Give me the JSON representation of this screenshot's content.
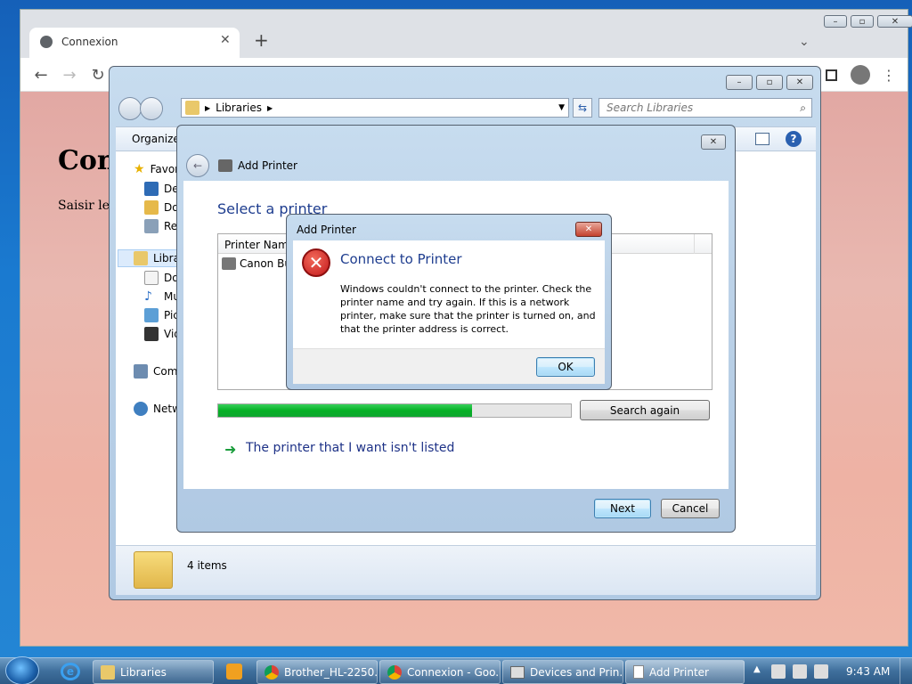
{
  "browser": {
    "tab_title": "Connexion",
    "heading": "Con",
    "body_text": "Saisir le s"
  },
  "explorer": {
    "breadcrumb": "Libraries",
    "search_placeholder": "Search Libraries",
    "organize_label": "Organize",
    "nav": {
      "favorites": "Favor",
      "desktop": "Des",
      "downloads": "Dov",
      "recent": "Rec",
      "libraries": "Libra",
      "documents": "Doc",
      "music": "Mu",
      "pictures": "Pic",
      "videos": "Vid",
      "computer": "Com",
      "network": "Netw"
    },
    "status": "4 items"
  },
  "wizard": {
    "title": "Add Printer",
    "heading": "Select a printer",
    "col_header": "Printer Name",
    "row": "Canon Bu",
    "search_again": "Search again",
    "not_listed": "The printer that I want isn't listed",
    "next": "Next",
    "cancel": "Cancel",
    "progress": 0.72
  },
  "dialog": {
    "title": "Add Printer",
    "heading": "Connect to Printer",
    "message": "Windows couldn't connect to the printer. Check the printer name and try again. If this is a network printer, make sure that the printer is turned on, and that the printer address is correct.",
    "ok": "OK"
  },
  "taskbar": {
    "items": [
      "Libraries",
      "Brother_HL-2250...",
      "Connexion - Goo...",
      "Devices and Prin...",
      "Add Printer"
    ],
    "time": "9:43 AM"
  },
  "colors": {
    "link_blue": "#1e3287",
    "progress_green": "#06b025",
    "heading_blue": "#1e3d8f"
  }
}
